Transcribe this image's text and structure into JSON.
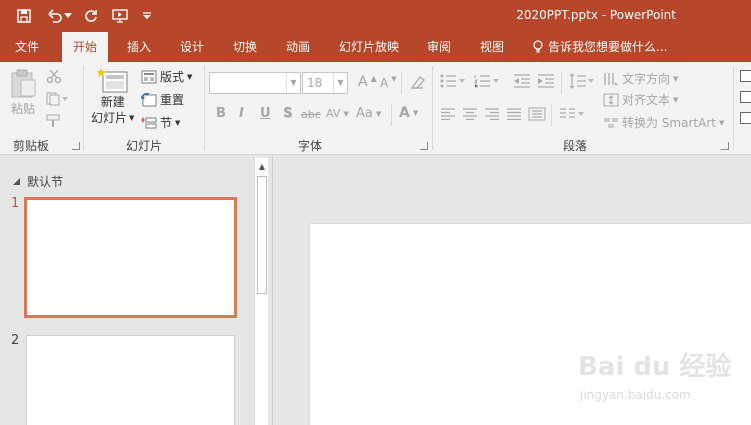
{
  "window": {
    "title": "2020PPT.pptx - PowerPoint",
    "quick_access": [
      "save-icon",
      "undo-icon",
      "redo-icon",
      "slideshow-from-start-icon",
      "customize-dropdown-icon"
    ]
  },
  "tabs": [
    {
      "label": "文件",
      "active": false
    },
    {
      "label": "开始",
      "active": true
    },
    {
      "label": "插入",
      "active": false
    },
    {
      "label": "设计",
      "active": false
    },
    {
      "label": "切换",
      "active": false
    },
    {
      "label": "动画",
      "active": false
    },
    {
      "label": "幻灯片放映",
      "active": false
    },
    {
      "label": "审阅",
      "active": false
    },
    {
      "label": "视图",
      "active": false
    }
  ],
  "tell_me": "告诉我您想要做什么...",
  "ribbon": {
    "clipboard": {
      "label": "剪贴板",
      "paste": "粘贴"
    },
    "slides": {
      "label": "幻灯片",
      "new_slide_line1": "新建",
      "new_slide_line2": "幻灯片",
      "layout": "版式",
      "reset": "重置",
      "section": "节"
    },
    "font": {
      "label": "字体",
      "font_name_value": "",
      "font_size_value": "18",
      "bold": "B",
      "italic": "I",
      "underline": "U",
      "shadow": "S",
      "strikethrough": "abc",
      "spacing": "AV",
      "change_case": "Aa",
      "font_color": "A",
      "grow": "A",
      "shrink": "A"
    },
    "paragraph": {
      "label": "段落",
      "text_direction": "文字方向",
      "align_text": "对齐文本",
      "convert_smartart": "转换为 SmartArt"
    }
  },
  "thumbnail_pane": {
    "section_name": "默认节",
    "slides": [
      {
        "number": "1",
        "selected": true
      },
      {
        "number": "2",
        "selected": false
      }
    ]
  },
  "watermark": {
    "main": "Bai du 经验",
    "sub": "jingyan.baidu.com"
  },
  "colors": {
    "accent": "#b7472a",
    "selection": "#d35230",
    "ribbon_bg": "#f3f3f3",
    "workspace_bg": "#e6e6e6"
  }
}
